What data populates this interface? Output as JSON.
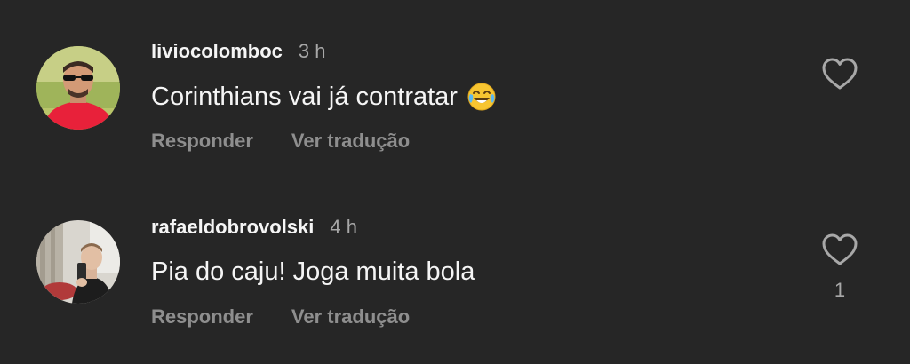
{
  "comments": [
    {
      "username": "liviocolomboc",
      "time": "3 h",
      "text": "Corinthians vai já contratar",
      "emoji": "face-with-tears-of-joy",
      "reply_label": "Responder",
      "translate_label": "Ver tradução",
      "like_count": ""
    },
    {
      "username": "rafaeldobrovolski",
      "time": "4 h",
      "text": "Pia do caju! Joga muita bola",
      "reply_label": "Responder",
      "translate_label": "Ver tradução",
      "like_count": "1"
    }
  ],
  "colors": {
    "background": "#262626",
    "primary_text": "#f5f5f5",
    "secondary_text": "#a8a8a8",
    "action_text": "#8e8e8e"
  }
}
